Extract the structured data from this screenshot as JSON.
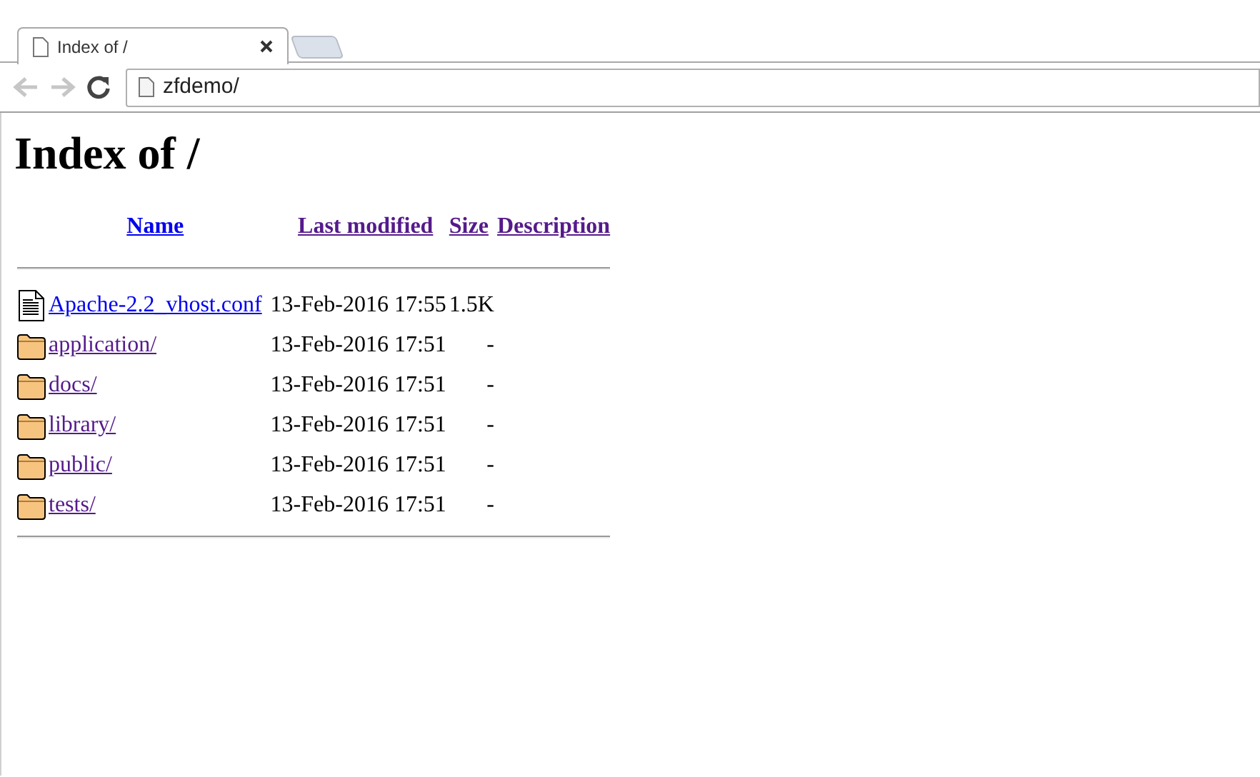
{
  "tab": {
    "title": "Index of /"
  },
  "address_bar": {
    "value": "zfdemo/"
  },
  "nav": {
    "back_disabled": true,
    "forward_disabled": true
  },
  "heading": "Index of /",
  "columns": [
    {
      "label": "Name",
      "visited": false
    },
    {
      "label": "Last modified",
      "visited": true
    },
    {
      "label": "Size",
      "visited": true
    },
    {
      "label": "Description",
      "visited": true
    }
  ],
  "rows": [
    {
      "kind": "file",
      "name": "Apache-2.2_vhost.conf",
      "visited": false,
      "modified": "13-Feb-2016 17:55",
      "size": "1.5K"
    },
    {
      "kind": "folder",
      "name": "application/",
      "visited": true,
      "modified": "13-Feb-2016 17:51",
      "size": "-"
    },
    {
      "kind": "folder",
      "name": "docs/",
      "visited": true,
      "modified": "13-Feb-2016 17:51",
      "size": "-"
    },
    {
      "kind": "folder",
      "name": "library/",
      "visited": true,
      "modified": "13-Feb-2016 17:51",
      "size": "-"
    },
    {
      "kind": "folder",
      "name": "public/",
      "visited": true,
      "modified": "13-Feb-2016 17:51",
      "size": "-"
    },
    {
      "kind": "folder",
      "name": "tests/",
      "visited": true,
      "modified": "13-Feb-2016 17:51",
      "size": "-"
    }
  ]
}
